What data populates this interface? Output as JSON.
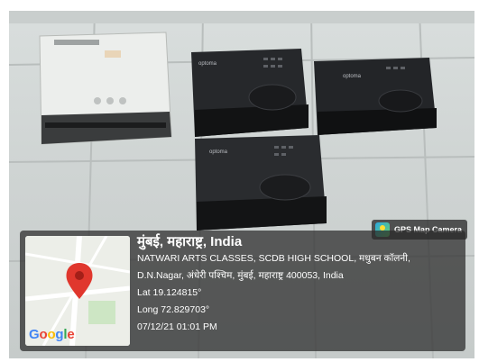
{
  "app_badge": {
    "label": "GPS Map Camera",
    "icon": "gps-map-camera-icon"
  },
  "location": {
    "place": "मुंबई, महाराष्ट्र, India",
    "address_line1": "NATWARI ARTS CLASSES, SCDB HIGH SCHOOL, मधुबन कॉलनी,",
    "address_line2": "D.N.Nagar, अंधेरी पश्चिम, मुंबई, महाराष्ट्र 400053, India",
    "lat": "Lat 19.124815°",
    "long": "Long 72.829703°",
    "datetime": "07/12/21 01:01 PM"
  },
  "map": {
    "logo_text": "Google",
    "pin_icon": "map-pin-icon"
  },
  "projector_brand": "optoma",
  "colors": {
    "pin": "#e0372d",
    "panel": "#2a2a2a"
  }
}
